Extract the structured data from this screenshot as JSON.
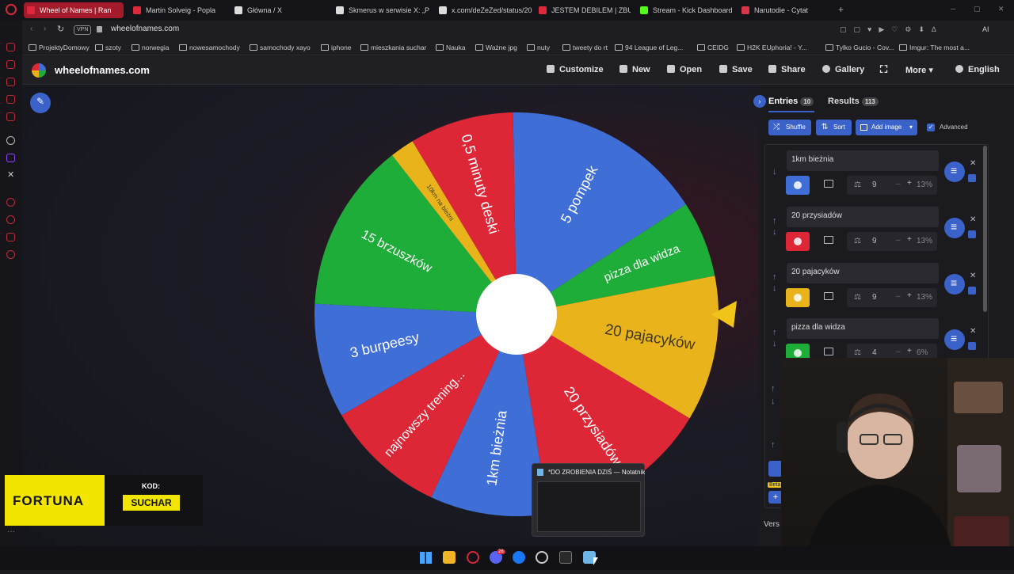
{
  "browser": {
    "tabs": [
      {
        "label": "Wheel of Names | Ran",
        "active": true,
        "color": "#e0283c"
      },
      {
        "label": "Martin Solveig - Popla",
        "active": false,
        "color": "#e0283c"
      },
      {
        "label": "Główna / X",
        "active": false,
        "color": "#dddddd"
      },
      {
        "label": "Skmerus w serwisie X: „P",
        "active": false,
        "color": "#dddddd"
      },
      {
        "label": "x.com/deZeZed/status/20",
        "active": false,
        "color": "#dddddd"
      },
      {
        "label": "JESTEM DEBILEM | ZBUD",
        "active": false,
        "color": "#e0283c"
      },
      {
        "label": "Stream - Kick Dashboard",
        "active": false,
        "color": "#53fc18"
      },
      {
        "label": "Narutodie - Cytat",
        "active": false,
        "color": "#d8344a"
      }
    ],
    "address": "wheelofnames.com",
    "vpn_label": "VPN",
    "bookmarks": [
      "ProjektyDomowy",
      "szoty",
      "norwegia",
      "nowesamochody",
      "samochody xayo",
      "iphone",
      "mieszkania suchar",
      "Nauka",
      "Ważne jpg",
      "nuty",
      "tweety do rt",
      "94 League of Leg...",
      "CEIDG",
      "H2K EUphoria! - Y...",
      "Tylko Gucio - Cov...",
      "Imgur: The most a..."
    ]
  },
  "site": {
    "logo_text": "wheelofnames.com",
    "nav": [
      "Customize",
      "New",
      "Open",
      "Save",
      "Share",
      "Gallery",
      "More",
      "English"
    ]
  },
  "wheel": {
    "center_color": "#ffffff",
    "pointer_color": "#f0c419",
    "segments": [
      {
        "label": "5 pompek",
        "color": "#3f6fd6"
      },
      {
        "label": "pizza dla widza",
        "color": "#1fad3a"
      },
      {
        "label": "20 pajacyków",
        "color": "#e9b31c"
      },
      {
        "label": "20 przysiadów",
        "color": "#dd2636"
      },
      {
        "label": "1km bieżnia",
        "color": "#3f6fd6"
      },
      {
        "label": "najnowszy trening...",
        "color": "#dd2636"
      },
      {
        "label": "3 burpeesy",
        "color": "#3f6fd6"
      },
      {
        "label": "15 brzuszków",
        "color": "#1fad3a"
      },
      {
        "label": "10km na bieżni",
        "color": "#e9b31c"
      },
      {
        "label": "0,5 minuty deski",
        "color": "#dd2636"
      }
    ]
  },
  "panel": {
    "tab_entries": "Entries",
    "entries_count": "10",
    "tab_results": "Results",
    "results_count": "113",
    "shuffle": "Shuffle",
    "sort": "Sort",
    "add_image": "Add image",
    "advanced": "Advanced",
    "entries": [
      {
        "name": "1km bieżnia",
        "weight": "9",
        "pct": "13%",
        "color": "#3f6fd6"
      },
      {
        "name": "20 przysiadów",
        "weight": "9",
        "pct": "13%",
        "color": "#dd2636"
      },
      {
        "name": "20 pajacyków",
        "weight": "9",
        "pct": "13%",
        "color": "#e9b31c"
      },
      {
        "name": "pizza dla widza",
        "weight": "4",
        "pct": "6%",
        "color": "#1fad3a"
      }
    ],
    "beta_label": "Beta",
    "version_label": "Vers"
  },
  "overlay": {
    "sponsor": "FORTUNA",
    "code_label": "KOD:",
    "code_value": "SUCHAR"
  },
  "taskbar": {
    "tooltip": "*DO ZROBIENIA DZIŚ — Notatnik",
    "discord_badge": "26"
  }
}
